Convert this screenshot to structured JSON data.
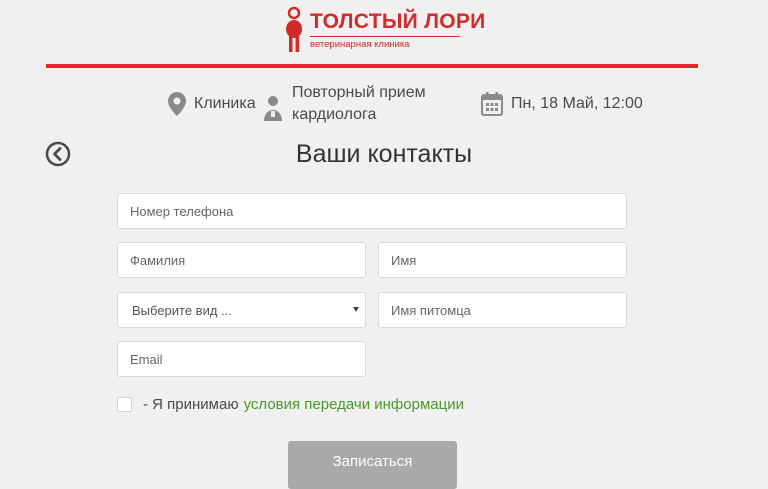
{
  "brand": {
    "name": "ТОЛСТЫЙ ЛОРИ",
    "tagline": "ветеринарная клиника",
    "color": "#d32b2b"
  },
  "summary": {
    "clinic": {
      "icon": "location-pin-icon",
      "text": "Клиника"
    },
    "service": {
      "icon": "doctor-icon",
      "text": "Повторный прием кардиолога"
    },
    "datetime": {
      "icon": "calendar-icon",
      "text": "Пн, 18 Май, 12:00"
    }
  },
  "page": {
    "title": "Ваши контакты",
    "back_icon": "back-arrow-icon"
  },
  "form": {
    "phone_placeholder": "Номер телефона",
    "surname_placeholder": "Фамилия",
    "name_placeholder": "Имя",
    "species_select_value": "Выберите вид ...",
    "pet_name_placeholder": "Имя питомца",
    "email_placeholder": "Email",
    "agree_prefix": "- Я принимаю",
    "agree_link": "условия передачи информации",
    "agree_checked": false,
    "submit_label": "Записаться"
  },
  "colors": {
    "accent_red": "#e02a2a",
    "link_green": "#4a9a2a",
    "button_gray": "#a9a9a9"
  }
}
